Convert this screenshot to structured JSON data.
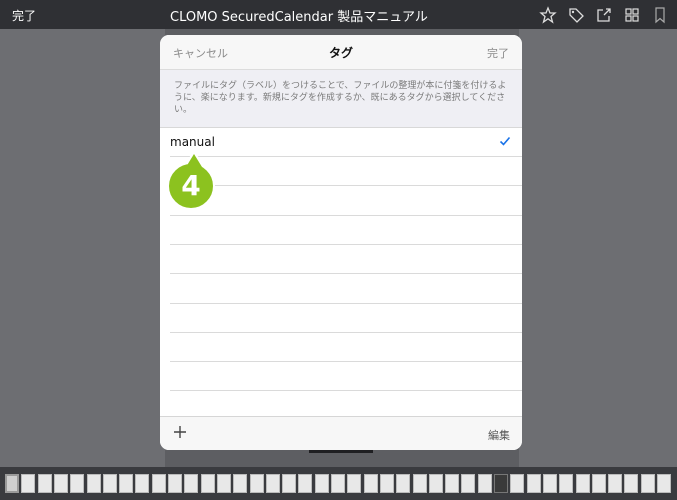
{
  "topbar": {
    "done_label": "完了",
    "title": "CLOMO SecuredCalendar 製品マニュアル",
    "icons": [
      "star-icon",
      "tag-icon",
      "share-icon",
      "grid-icon",
      "bookmark-icon"
    ]
  },
  "modal": {
    "cancel_label": "キャンセル",
    "title": "タグ",
    "done_label": "完了",
    "description": "ファイルにタグ（ラベル）をつけることで、ファイルの整理が本に付箋を付けるように、楽になります。新規にタグを作成するか、既にあるタグから選択してください。",
    "tags": [
      {
        "label": "manual",
        "checked": true
      }
    ],
    "empty_rows": 8,
    "add_icon": "plus-icon",
    "edit_label": "編集"
  },
  "callout": {
    "number": "4",
    "color": "#8cc21f"
  },
  "colors": {
    "accent": "#1a73e8",
    "topbar": "#2f3034",
    "backdrop": "#6d6e72"
  }
}
